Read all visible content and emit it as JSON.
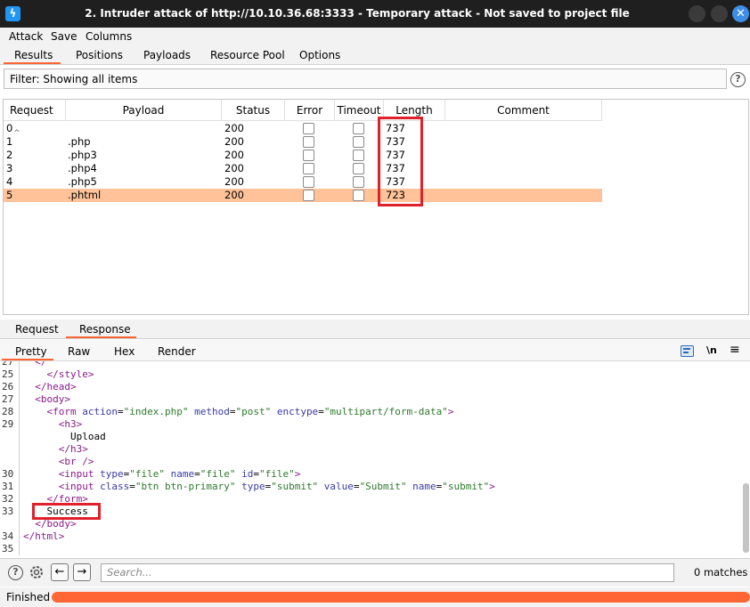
{
  "window": {
    "title": "2. Intruder attack of http://10.10.36.68:3333 - Temporary attack - Not saved to project file",
    "app_icon": "burp-lightning-icon",
    "close_glyph": "✕"
  },
  "menu": [
    "Attack",
    "Save",
    "Columns"
  ],
  "tabs": [
    "Results",
    "Positions",
    "Payloads",
    "Resource Pool",
    "Options"
  ],
  "active_tab": "Results",
  "filter": {
    "text": "Filter: Showing all items"
  },
  "help_glyph": "?",
  "table": {
    "columns": [
      "Request",
      "Payload",
      "Status",
      "Error",
      "Timeout",
      "Length",
      "Comment"
    ],
    "sort_indicator": "^",
    "rows": [
      {
        "request": "0",
        "payload": "",
        "status": "200",
        "length": "737",
        "comment": ""
      },
      {
        "request": "1",
        "payload": ".php",
        "status": "200",
        "length": "737",
        "comment": ""
      },
      {
        "request": "2",
        "payload": ".php3",
        "status": "200",
        "length": "737",
        "comment": ""
      },
      {
        "request": "3",
        "payload": ".php4",
        "status": "200",
        "length": "737",
        "comment": ""
      },
      {
        "request": "4",
        "payload": ".php5",
        "status": "200",
        "length": "737",
        "comment": ""
      },
      {
        "request": "5",
        "payload": ".phtml",
        "status": "200",
        "length": "723",
        "comment": ""
      }
    ],
    "selected_row": 5
  },
  "lower_tabs": [
    "Request",
    "Response"
  ],
  "lower_active": "Response",
  "view_tabs": [
    "Pretty",
    "Raw",
    "Hex",
    "Render"
  ],
  "view_active": "Pretty",
  "view_actions": {
    "wrap_icon": "word-wrap-icon",
    "newline": "\\n",
    "menu_glyph": "≡"
  },
  "code": {
    "line_numbers": [
      "27",
      "25",
      "26",
      "27",
      "28",
      "29",
      "",
      "",
      "",
      "30",
      "31",
      "32",
      "33",
      "",
      "34",
      "35"
    ],
    "lines": [
      [
        {
          "t": "  </",
          "c": "tag"
        }
      ],
      [
        {
          "t": "    </",
          "c": "tag"
        },
        {
          "t": "style",
          "c": "tag"
        },
        {
          "t": ">",
          "c": "tag"
        }
      ],
      [
        {
          "t": "  </",
          "c": "tag"
        },
        {
          "t": "head",
          "c": "tag"
        },
        {
          "t": ">",
          "c": "tag"
        }
      ],
      [
        {
          "t": "  <",
          "c": "tag"
        },
        {
          "t": "body",
          "c": "tag"
        },
        {
          "t": ">",
          "c": "tag"
        }
      ],
      [
        {
          "t": "    <",
          "c": "tag"
        },
        {
          "t": "form",
          "c": "tag"
        },
        {
          "t": " action",
          "c": "attr"
        },
        {
          "t": "=",
          "c": ""
        },
        {
          "t": "\"index.php\"",
          "c": "str"
        },
        {
          "t": " method",
          "c": "attr"
        },
        {
          "t": "=",
          "c": ""
        },
        {
          "t": "\"post\"",
          "c": "str"
        },
        {
          "t": " enctype",
          "c": "attr"
        },
        {
          "t": "=",
          "c": ""
        },
        {
          "t": "\"multipart/form-data\"",
          "c": "str"
        },
        {
          "t": ">",
          "c": "tag"
        }
      ],
      [
        {
          "t": "      <",
          "c": "tag"
        },
        {
          "t": "h3",
          "c": "tag"
        },
        {
          "t": ">",
          "c": "tag"
        }
      ],
      [
        {
          "t": "        Upload",
          "c": ""
        }
      ],
      [
        {
          "t": "      </",
          "c": "tag"
        },
        {
          "t": "h3",
          "c": "tag"
        },
        {
          "t": ">",
          "c": "tag"
        }
      ],
      [
        {
          "t": "      <",
          "c": "tag"
        },
        {
          "t": "br",
          "c": "tag"
        },
        {
          "t": " />",
          "c": "tag"
        }
      ],
      [
        {
          "t": "      <",
          "c": "tag"
        },
        {
          "t": "input",
          "c": "tag"
        },
        {
          "t": " type",
          "c": "attr"
        },
        {
          "t": "=",
          "c": ""
        },
        {
          "t": "\"file\"",
          "c": "str"
        },
        {
          "t": " name",
          "c": "attr"
        },
        {
          "t": "=",
          "c": ""
        },
        {
          "t": "\"file\"",
          "c": "str"
        },
        {
          "t": " id",
          "c": "attr"
        },
        {
          "t": "=",
          "c": ""
        },
        {
          "t": "\"file\"",
          "c": "str"
        },
        {
          "t": ">",
          "c": "tag"
        }
      ],
      [
        {
          "t": "      <",
          "c": "tag"
        },
        {
          "t": "input",
          "c": "tag"
        },
        {
          "t": " class",
          "c": "attr"
        },
        {
          "t": "=",
          "c": ""
        },
        {
          "t": "\"btn btn-primary\"",
          "c": "str"
        },
        {
          "t": " type",
          "c": "attr"
        },
        {
          "t": "=",
          "c": ""
        },
        {
          "t": "\"submit\"",
          "c": "str"
        },
        {
          "t": " value",
          "c": "attr"
        },
        {
          "t": "=",
          "c": ""
        },
        {
          "t": "\"Submit\"",
          "c": "str"
        },
        {
          "t": " name",
          "c": "attr"
        },
        {
          "t": "=",
          "c": ""
        },
        {
          "t": "\"submit\"",
          "c": "str"
        },
        {
          "t": ">",
          "c": "tag"
        }
      ],
      [
        {
          "t": "    </",
          "c": "tag"
        },
        {
          "t": "form",
          "c": "tag"
        },
        {
          "t": ">",
          "c": "tag"
        }
      ],
      [
        {
          "t": "    Success",
          "c": ""
        }
      ],
      [
        {
          "t": "  </",
          "c": "tag"
        },
        {
          "t": "body",
          "c": "tag"
        },
        {
          "t": ">",
          "c": "tag"
        }
      ],
      [
        {
          "t": "</",
          "c": "tag"
        },
        {
          "t": "html",
          "c": "tag"
        },
        {
          "t": ">",
          "c": "tag"
        }
      ],
      []
    ]
  },
  "search": {
    "placeholder": "Search...",
    "matches": "0 matches"
  },
  "status": {
    "text": "Finished",
    "progress": 1.0
  },
  "colors": {
    "accent": "#ff6633",
    "selected_row": "#ffc299",
    "highlight": "#e0202a"
  }
}
